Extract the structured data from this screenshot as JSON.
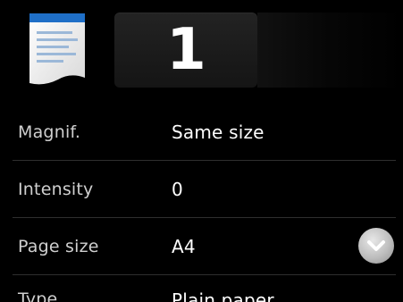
{
  "header": {
    "document_icon": "document-icon",
    "copies": "1"
  },
  "settings": [
    {
      "label": "Magnif.",
      "value": "Same size"
    },
    {
      "label": "Intensity",
      "value": "0"
    },
    {
      "label": "Page size",
      "value": "A4"
    },
    {
      "label": "Type",
      "value": "Plain paper"
    }
  ],
  "scroll_button": {
    "icon": "chevron-down-icon"
  }
}
